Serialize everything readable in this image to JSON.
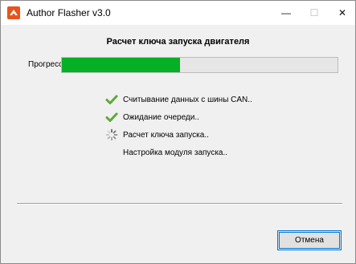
{
  "window": {
    "title": "Author Flasher v3.0",
    "icon": "app-logo-icon",
    "controls": {
      "minimize": "—",
      "maximize": "☐",
      "close": "✕"
    }
  },
  "main": {
    "heading": "Расчет ключа запуска двигателя",
    "progress": {
      "label": "Прогресс:",
      "percent": 43,
      "fill_color": "#06b025"
    },
    "steps": [
      {
        "label": "Считывание данных с шины CAN..",
        "status": "done",
        "icon": "checkmark-icon"
      },
      {
        "label": "Ожидание очереди..",
        "status": "done",
        "icon": "checkmark-icon"
      },
      {
        "label": "Расчет ключа запуска..",
        "status": "in-progress",
        "icon": "spinner-icon"
      },
      {
        "label": "Настройка модуля запуска..",
        "status": "pending",
        "icon": ""
      }
    ]
  },
  "footer": {
    "cancel_label": "Отмена"
  },
  "colors": {
    "accent": "#0078d7",
    "check": "#5fa83a",
    "progress": "#06b025"
  }
}
